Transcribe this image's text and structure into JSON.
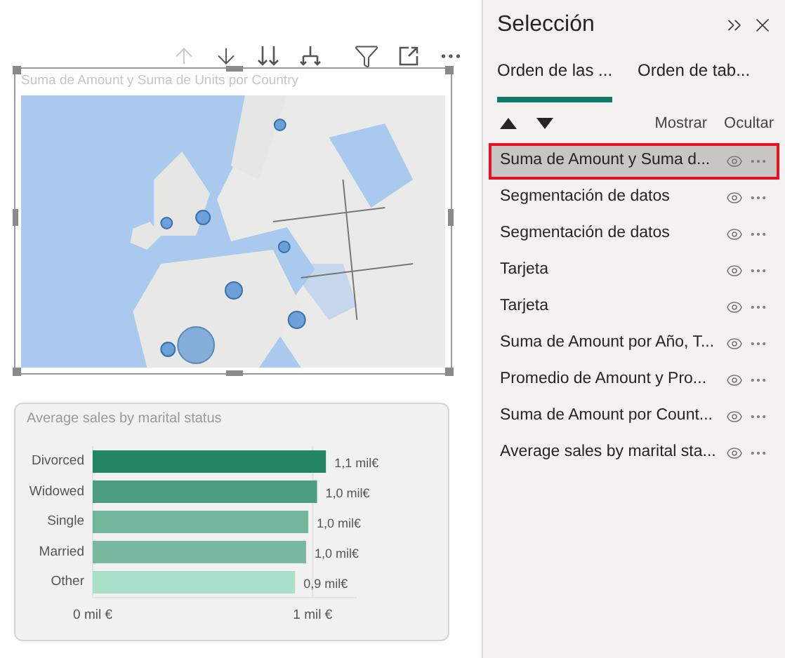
{
  "map_visual": {
    "title": "Suma de Amount y Suma de Units por Country",
    "selected": true,
    "toolbar": [
      {
        "kind": "up",
        "disabled": true
      },
      {
        "kind": "down",
        "disabled": false
      },
      {
        "kind": "double-down",
        "disabled": false
      },
      {
        "kind": "expand-down",
        "disabled": false
      },
      {
        "kind": "filter",
        "disabled": false
      },
      {
        "kind": "focus",
        "disabled": false
      },
      {
        "kind": "more",
        "disabled": false
      }
    ]
  },
  "bar_visual": {
    "chart_data": {
      "type": "bar",
      "orientation": "horizontal",
      "title": "Average sales by marital status",
      "categories": [
        "Divorced",
        "Widowed",
        "Single",
        "Married",
        "Other"
      ],
      "xlim": [
        0,
        1.2
      ],
      "series": [
        {
          "colors": [
            "#218563",
            "#4a9d7e",
            "#72b69c",
            "#79b9a0",
            "#aadfca"
          ],
          "values": [
            1.06,
            1.02,
            0.98,
            0.97,
            0.92
          ]
        }
      ],
      "xticks": [
        {
          "value": 0,
          "label": "0 mil €"
        },
        {
          "value": 1,
          "label": "1 mil €"
        }
      ],
      "value_labels": [
        "1,1 mil€",
        "1,0 mil€",
        "1,0 mil€",
        "1,0 mil€",
        "0,9 mil€"
      ]
    }
  },
  "selection_pane": {
    "title": "Selección",
    "tabs": [
      {
        "label": "Orden de las ...",
        "selected": true
      },
      {
        "label": "Orden de tab...",
        "selected": false
      }
    ],
    "actions": [
      "Mostrar",
      "Ocultar"
    ],
    "items": [
      {
        "label": "Suma de Amount y Suma d...",
        "selected": true,
        "visible": true
      },
      {
        "label": "Segmentación de datos",
        "selected": false,
        "visible": true
      },
      {
        "label": "Segmentación de datos",
        "selected": false,
        "visible": true
      },
      {
        "label": "Tarjeta",
        "selected": false,
        "visible": true
      },
      {
        "label": "Tarjeta",
        "selected": false,
        "visible": true
      },
      {
        "label": "Suma de Amount por Año, T...",
        "selected": false,
        "visible": true
      },
      {
        "label": "Promedio de Amount y Pro...",
        "selected": false,
        "visible": true
      },
      {
        "label": "Suma de Amount por Count...",
        "selected": false,
        "visible": true
      },
      {
        "label": "Average sales by marital sta...",
        "selected": false,
        "visible": true
      }
    ]
  }
}
